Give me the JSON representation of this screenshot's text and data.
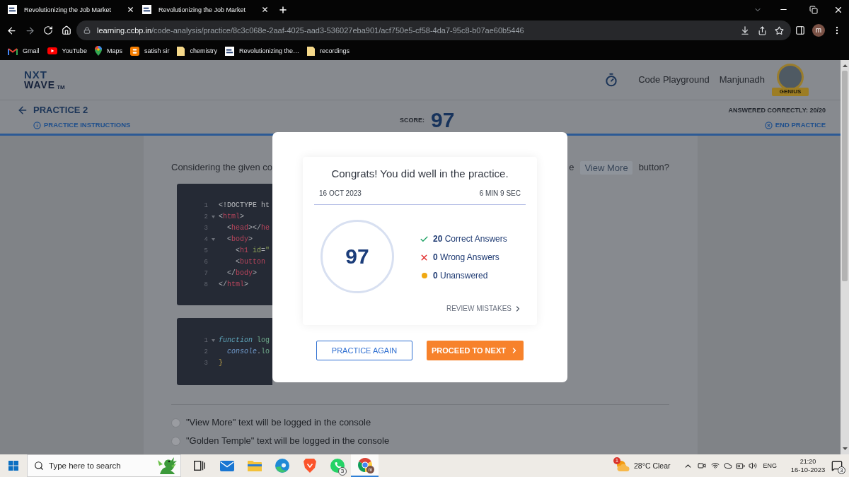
{
  "browser": {
    "tabs": [
      {
        "title": "Revolutionizing the Job Market"
      },
      {
        "title": "Revolutionizing the Job Market"
      }
    ],
    "url_host": "learning.ccbp.in",
    "url_path": "/code-analysis/practice/8c3c068e-2aaf-4025-aad3-536027eba901/acf750e5-cf58-4da7-95c8-b07ae60b5446",
    "profile_initial": "m",
    "bookmarks": [
      {
        "kind": "gmail",
        "label": "Gmail"
      },
      {
        "kind": "youtube",
        "label": "YouTube"
      },
      {
        "kind": "maps",
        "label": "Maps"
      },
      {
        "kind": "blogger",
        "label": "satish sir"
      },
      {
        "kind": "folder",
        "label": "chemistry"
      },
      {
        "kind": "site",
        "label": "Revolutionizing the…"
      },
      {
        "kind": "folder",
        "label": "recordings"
      }
    ]
  },
  "header": {
    "logo_top": "NXT",
    "logo_bottom": "WAVE",
    "logo_mark": "TM",
    "link": "Code Playground",
    "user_name": "Manjunadh",
    "rank": "GENIUS"
  },
  "practice_bar": {
    "title": "PRACTICE 2",
    "instructions": "PRACTICE INSTRUCTIONS",
    "score_label": "SCORE:",
    "score": "97",
    "answered": "ANSWERED CORRECTLY: 20/20",
    "end": "END PRACTICE"
  },
  "question": {
    "text_start": "Considering the given co",
    "text_end": "e",
    "code": "View More",
    "text_after": "button?"
  },
  "code_blocks": [
    {
      "lines": [
        {
          "number": "1",
          "foldable": false,
          "tokens": [
            {
              "kind": "plain",
              "text": "<!DOCTYPE ht"
            }
          ]
        },
        {
          "number": "2",
          "foldable": true,
          "tokens": [
            {
              "kind": "punct",
              "text": "<"
            },
            {
              "kind": "tag",
              "text": "html"
            },
            {
              "kind": "punct",
              "text": ">"
            }
          ]
        },
        {
          "number": "3",
          "foldable": false,
          "tokens": [
            {
              "kind": "punct",
              "text": "  <"
            },
            {
              "kind": "tag",
              "text": "head"
            },
            {
              "kind": "punct",
              "text": "></"
            },
            {
              "kind": "tag",
              "text": "he"
            }
          ]
        },
        {
          "number": "4",
          "foldable": true,
          "tokens": [
            {
              "kind": "punct",
              "text": "  <"
            },
            {
              "kind": "tag",
              "text": "body"
            },
            {
              "kind": "punct",
              "text": ">"
            }
          ]
        },
        {
          "number": "5",
          "foldable": false,
          "tokens": [
            {
              "kind": "punct",
              "text": "    <"
            },
            {
              "kind": "tag",
              "text": "h1"
            },
            {
              "kind": "attr",
              "text": " id"
            },
            {
              "kind": "punct",
              "text": "="
            },
            {
              "kind": "string",
              "text": "\""
            }
          ]
        },
        {
          "number": "6",
          "foldable": false,
          "tokens": [
            {
              "kind": "punct",
              "text": "    <"
            },
            {
              "kind": "tag",
              "text": "button"
            }
          ]
        },
        {
          "number": "7",
          "foldable": false,
          "tokens": [
            {
              "kind": "punct",
              "text": "  </"
            },
            {
              "kind": "tag",
              "text": "body"
            },
            {
              "kind": "punct",
              "text": ">"
            }
          ]
        },
        {
          "number": "8",
          "foldable": false,
          "tokens": [
            {
              "kind": "punct",
              "text": "</"
            },
            {
              "kind": "tag",
              "text": "html"
            },
            {
              "kind": "punct",
              "text": ">"
            }
          ]
        }
      ]
    },
    {
      "lines": [
        {
          "number": "1",
          "foldable": true,
          "tokens": [
            {
              "kind": "keyword",
              "text": "function"
            },
            {
              "kind": "function_name",
              "text": " log"
            }
          ]
        },
        {
          "number": "2",
          "foldable": false,
          "tokens": [
            {
              "kind": "object",
              "text": "  console"
            },
            {
              "kind": "punct",
              "text": "."
            },
            {
              "kind": "function_name",
              "text": "lo"
            }
          ]
        },
        {
          "number": "3",
          "foldable": false,
          "tokens": [
            {
              "kind": "brace",
              "text": "}"
            }
          ]
        }
      ]
    }
  ],
  "options": [
    {
      "text": "\"View More\" text will be logged in the console",
      "selected": false
    },
    {
      "text": "\"Golden Temple\" text will be logged in the console",
      "selected": false
    }
  ],
  "result_modal": {
    "title": "Congrats! You did well in the practice.",
    "date": "16 OCT 2023",
    "duration": "6 MIN 9 SEC",
    "score": "97",
    "stats": [
      {
        "kind": "correct",
        "text": "**20** Correct Answers"
      },
      {
        "kind": "wrong",
        "text": "**0** Wrong Answers"
      },
      {
        "kind": "unanswered",
        "text": "**0** Unanswered"
      }
    ],
    "review_link": "REVIEW MISTAKES",
    "buttons": [
      {
        "kind": "outline",
        "label": "PRACTICE AGAIN"
      },
      {
        "kind": "primary",
        "label": "PROCEED TO NEXT"
      }
    ]
  },
  "taskbar": {
    "search_placeholder": "Type here to search",
    "apps": [
      {
        "kind": "task_view",
        "active": false
      },
      {
        "kind": "mail",
        "active": false
      },
      {
        "kind": "files",
        "active": false
      },
      {
        "kind": "edge",
        "active": false
      },
      {
        "kind": "brave",
        "active": false
      },
      {
        "kind": "whatsapp",
        "active": false,
        "badge": "3"
      },
      {
        "kind": "chrome",
        "active": true,
        "avatar": "m"
      }
    ],
    "weather": {
      "badge": "1",
      "text": "28°C Clear"
    },
    "language": "ENG",
    "time": "21:20",
    "date": "16-10-2023",
    "notifications": "3"
  }
}
